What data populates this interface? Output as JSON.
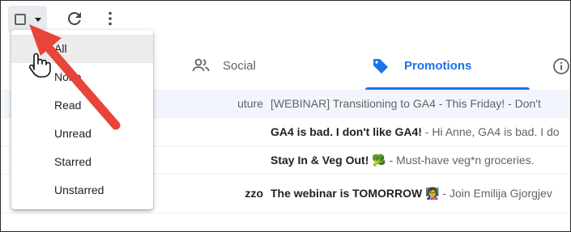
{
  "toolbar": {
    "select_checkbox": "select-checkbox",
    "caret_icon": "caret-down-icon",
    "refresh_icon": "refresh-icon",
    "more_icon": "more-vert-icon"
  },
  "tabs": [
    {
      "label": "Social",
      "icon": "people-icon"
    },
    {
      "label": "Promotions",
      "icon": "tag-icon",
      "active": true
    }
  ],
  "emails": [
    {
      "sender": "uture",
      "subject": "[WEBINAR] Transitioning to GA4 - This Friday!",
      "snippet": " - Don't",
      "read": true
    },
    {
      "sender": "",
      "subject": "GA4 is bad. I don't like GA4!",
      "snippet": " - Hi Anne, GA4 is bad. I do",
      "read": false
    },
    {
      "sender": "",
      "subject": "Stay In & Veg Out! 🥦",
      "snippet": " - Must-have veg*n groceries.",
      "read": false
    },
    {
      "sender": "zzo",
      "subject": "The webinar is TOMORROW 👩‍🏫",
      "snippet": " - Join Emilija Gjorgjev",
      "read": false
    }
  ],
  "select_menu": {
    "items": [
      "All",
      "None",
      "Read",
      "Unread",
      "Starred",
      "Unstarred"
    ],
    "hovered": "All"
  },
  "colors": {
    "accent": "#1a73e8",
    "arrow": "#e8443a"
  }
}
